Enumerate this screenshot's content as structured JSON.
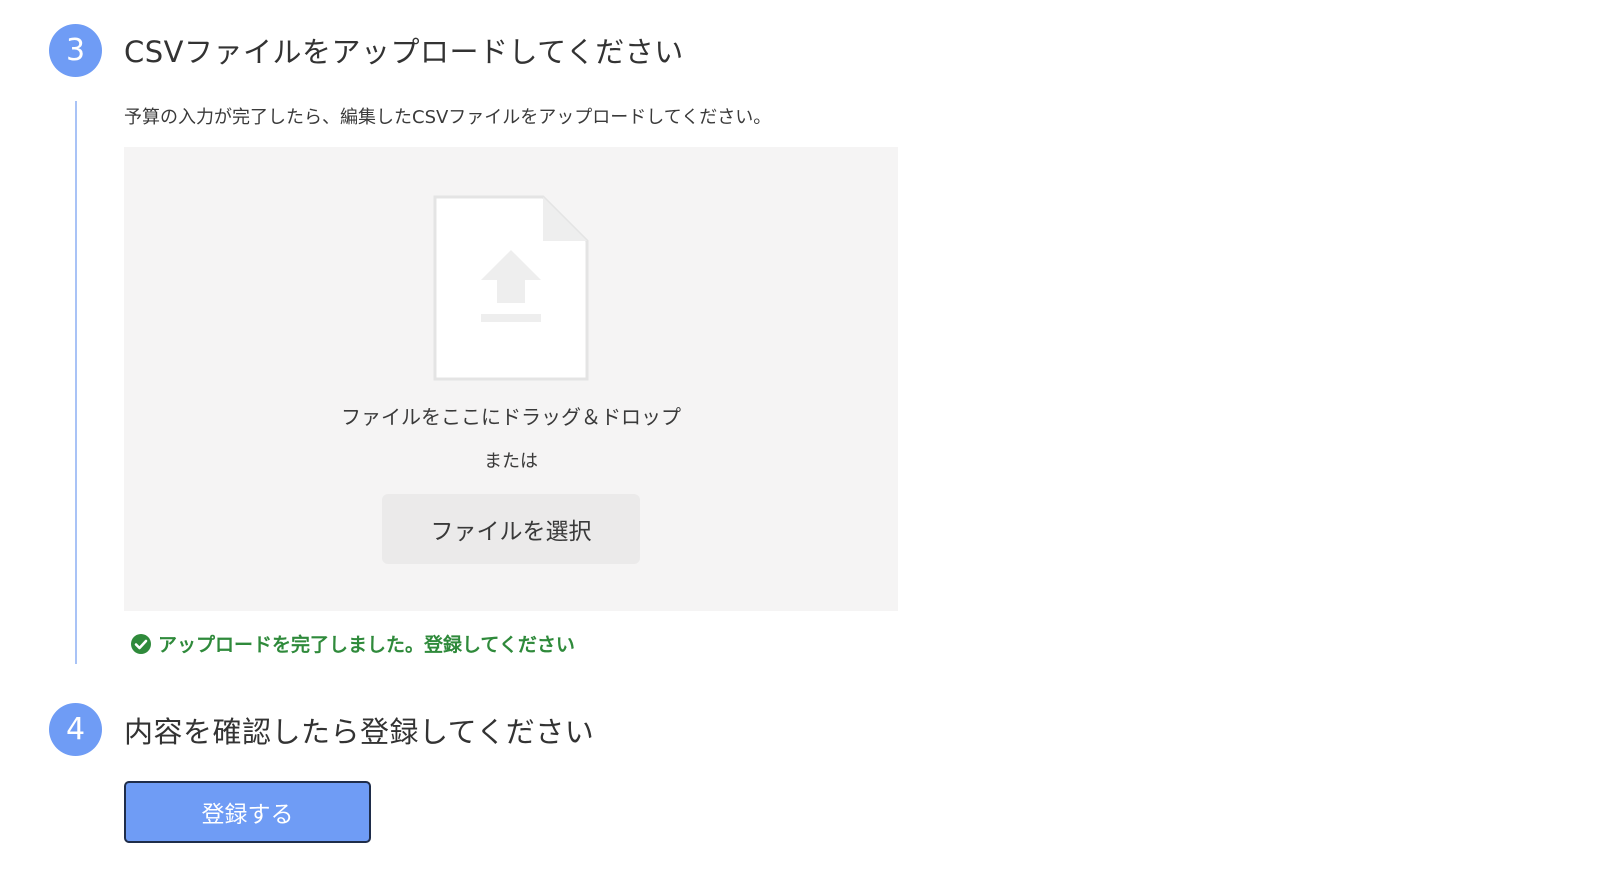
{
  "step3": {
    "number": "3",
    "title": "CSVファイルをアップロードしてください",
    "description": "予算の入力が完了したら、編集したCSVファイルをアップロードしてください。"
  },
  "dropzone": {
    "icon": "file-upload-icon",
    "drop_text": "ファイルをここにドラッグ＆ドロップ",
    "or_text": "または",
    "select_button": "ファイルを選択"
  },
  "status": {
    "icon": "check-circle-icon",
    "message": "アップロードを完了しました。登録してください",
    "color": "#2f8a3b"
  },
  "step4": {
    "number": "4",
    "title": "内容を確認したら登録してください",
    "register_button": "登録する"
  },
  "colors": {
    "accent": "#6f9cf5",
    "step_line": "#a9c3f6",
    "dropzone_bg": "#f5f4f4"
  }
}
